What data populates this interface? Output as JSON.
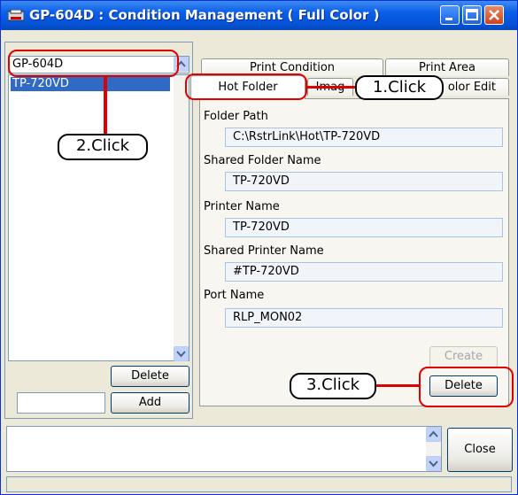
{
  "window": {
    "title": "GP-604D : Condition Management ( Full Color )"
  },
  "printers": {
    "selected_printer": "GP-604D",
    "items": [
      "TP-720VD"
    ],
    "delete_label": "Delete",
    "add_label": "Add",
    "add_value": ""
  },
  "tabs": {
    "row1": [
      "Print Condition",
      "Print Area"
    ],
    "row2": [
      "Hot Folder",
      "Image",
      "Color Edit"
    ],
    "row2_visible": [
      "Hot Folder",
      "Imag",
      "olor Edit"
    ]
  },
  "hot_folder": {
    "folder_path_label": "Folder Path",
    "folder_path_value": "C:\\RstrLink\\Hot\\TP-720VD",
    "shared_folder_label": "Shared Folder Name",
    "shared_folder_value": "TP-720VD",
    "printer_name_label": "Printer Name",
    "printer_name_value": "TP-720VD",
    "shared_printer_label": "Shared Printer Name",
    "shared_printer_value": "#TP-720VD",
    "port_name_label": "Port Name",
    "port_name_value": "RLP_MON02",
    "create_label": "Create",
    "delete_label": "Delete"
  },
  "bottom": {
    "message": "",
    "close_label": "Close",
    "status": ""
  },
  "annotations": {
    "step1": "1.Click",
    "step2": "2.Click",
    "step3": "3.Click"
  },
  "colors": {
    "callout": "#e00000",
    "title_blue": "#0553d6",
    "selection": "#316ac5"
  }
}
